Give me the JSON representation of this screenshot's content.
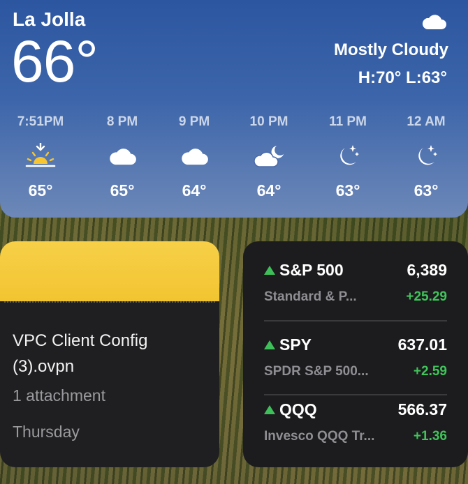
{
  "weather": {
    "city": "La Jolla",
    "temperature": "66°",
    "condition": "Mostly Cloudy",
    "hilo": "H:70° L:63°",
    "hours": [
      {
        "time": "7:51PM",
        "icon": "sunset-icon",
        "temp": "65°"
      },
      {
        "time": "8 PM",
        "icon": "cloud-icon",
        "temp": "65°"
      },
      {
        "time": "9 PM",
        "icon": "cloud-icon",
        "temp": "64°"
      },
      {
        "time": "10 PM",
        "icon": "cloud-moon-icon",
        "temp": "64°"
      },
      {
        "time": "11 PM",
        "icon": "moon-stars-icon",
        "temp": "63°"
      },
      {
        "time": "12 AM",
        "icon": "moon-stars-icon",
        "temp": "63°"
      }
    ]
  },
  "note": {
    "title_line1": "VPC Client Config",
    "title_line2": "(3).ovpn",
    "attachments": "1 attachment",
    "date": "Thursday",
    "accent": "#f5cb3d"
  },
  "stocks": [
    {
      "symbol": "S&P 500",
      "price": "6,389",
      "name": "Standard & P...",
      "change": "+25.29",
      "trend": "up"
    },
    {
      "symbol": "SPY",
      "price": "637.01",
      "name": "SPDR S&P 500...",
      "change": "+2.59",
      "trend": "up"
    },
    {
      "symbol": "QQQ",
      "price": "566.37",
      "name": "Invesco QQQ Tr...",
      "change": "+1.36",
      "trend": "up"
    }
  ],
  "colors": {
    "up": "#40c45b",
    "weather_bg_top": "#2c56a0",
    "weather_bg_bottom": "#6d88b8"
  }
}
